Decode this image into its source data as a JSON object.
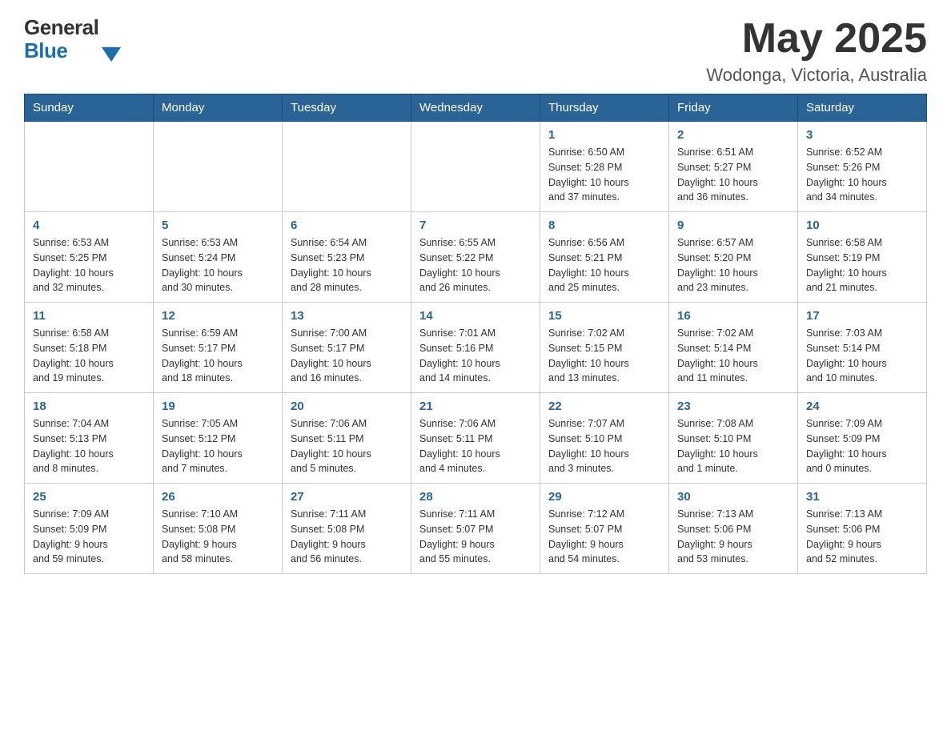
{
  "header": {
    "logo_general": "General",
    "logo_blue": "Blue",
    "month_year": "May 2025",
    "location": "Wodonga, Victoria, Australia"
  },
  "weekdays": [
    "Sunday",
    "Monday",
    "Tuesday",
    "Wednesday",
    "Thursday",
    "Friday",
    "Saturday"
  ],
  "weeks": [
    [
      {
        "day": "",
        "info": ""
      },
      {
        "day": "",
        "info": ""
      },
      {
        "day": "",
        "info": ""
      },
      {
        "day": "",
        "info": ""
      },
      {
        "day": "1",
        "info": "Sunrise: 6:50 AM\nSunset: 5:28 PM\nDaylight: 10 hours\nand 37 minutes."
      },
      {
        "day": "2",
        "info": "Sunrise: 6:51 AM\nSunset: 5:27 PM\nDaylight: 10 hours\nand 36 minutes."
      },
      {
        "day": "3",
        "info": "Sunrise: 6:52 AM\nSunset: 5:26 PM\nDaylight: 10 hours\nand 34 minutes."
      }
    ],
    [
      {
        "day": "4",
        "info": "Sunrise: 6:53 AM\nSunset: 5:25 PM\nDaylight: 10 hours\nand 32 minutes."
      },
      {
        "day": "5",
        "info": "Sunrise: 6:53 AM\nSunset: 5:24 PM\nDaylight: 10 hours\nand 30 minutes."
      },
      {
        "day": "6",
        "info": "Sunrise: 6:54 AM\nSunset: 5:23 PM\nDaylight: 10 hours\nand 28 minutes."
      },
      {
        "day": "7",
        "info": "Sunrise: 6:55 AM\nSunset: 5:22 PM\nDaylight: 10 hours\nand 26 minutes."
      },
      {
        "day": "8",
        "info": "Sunrise: 6:56 AM\nSunset: 5:21 PM\nDaylight: 10 hours\nand 25 minutes."
      },
      {
        "day": "9",
        "info": "Sunrise: 6:57 AM\nSunset: 5:20 PM\nDaylight: 10 hours\nand 23 minutes."
      },
      {
        "day": "10",
        "info": "Sunrise: 6:58 AM\nSunset: 5:19 PM\nDaylight: 10 hours\nand 21 minutes."
      }
    ],
    [
      {
        "day": "11",
        "info": "Sunrise: 6:58 AM\nSunset: 5:18 PM\nDaylight: 10 hours\nand 19 minutes."
      },
      {
        "day": "12",
        "info": "Sunrise: 6:59 AM\nSunset: 5:17 PM\nDaylight: 10 hours\nand 18 minutes."
      },
      {
        "day": "13",
        "info": "Sunrise: 7:00 AM\nSunset: 5:17 PM\nDaylight: 10 hours\nand 16 minutes."
      },
      {
        "day": "14",
        "info": "Sunrise: 7:01 AM\nSunset: 5:16 PM\nDaylight: 10 hours\nand 14 minutes."
      },
      {
        "day": "15",
        "info": "Sunrise: 7:02 AM\nSunset: 5:15 PM\nDaylight: 10 hours\nand 13 minutes."
      },
      {
        "day": "16",
        "info": "Sunrise: 7:02 AM\nSunset: 5:14 PM\nDaylight: 10 hours\nand 11 minutes."
      },
      {
        "day": "17",
        "info": "Sunrise: 7:03 AM\nSunset: 5:14 PM\nDaylight: 10 hours\nand 10 minutes."
      }
    ],
    [
      {
        "day": "18",
        "info": "Sunrise: 7:04 AM\nSunset: 5:13 PM\nDaylight: 10 hours\nand 8 minutes."
      },
      {
        "day": "19",
        "info": "Sunrise: 7:05 AM\nSunset: 5:12 PM\nDaylight: 10 hours\nand 7 minutes."
      },
      {
        "day": "20",
        "info": "Sunrise: 7:06 AM\nSunset: 5:11 PM\nDaylight: 10 hours\nand 5 minutes."
      },
      {
        "day": "21",
        "info": "Sunrise: 7:06 AM\nSunset: 5:11 PM\nDaylight: 10 hours\nand 4 minutes."
      },
      {
        "day": "22",
        "info": "Sunrise: 7:07 AM\nSunset: 5:10 PM\nDaylight: 10 hours\nand 3 minutes."
      },
      {
        "day": "23",
        "info": "Sunrise: 7:08 AM\nSunset: 5:10 PM\nDaylight: 10 hours\nand 1 minute."
      },
      {
        "day": "24",
        "info": "Sunrise: 7:09 AM\nSunset: 5:09 PM\nDaylight: 10 hours\nand 0 minutes."
      }
    ],
    [
      {
        "day": "25",
        "info": "Sunrise: 7:09 AM\nSunset: 5:09 PM\nDaylight: 9 hours\nand 59 minutes."
      },
      {
        "day": "26",
        "info": "Sunrise: 7:10 AM\nSunset: 5:08 PM\nDaylight: 9 hours\nand 58 minutes."
      },
      {
        "day": "27",
        "info": "Sunrise: 7:11 AM\nSunset: 5:08 PM\nDaylight: 9 hours\nand 56 minutes."
      },
      {
        "day": "28",
        "info": "Sunrise: 7:11 AM\nSunset: 5:07 PM\nDaylight: 9 hours\nand 55 minutes."
      },
      {
        "day": "29",
        "info": "Sunrise: 7:12 AM\nSunset: 5:07 PM\nDaylight: 9 hours\nand 54 minutes."
      },
      {
        "day": "30",
        "info": "Sunrise: 7:13 AM\nSunset: 5:06 PM\nDaylight: 9 hours\nand 53 minutes."
      },
      {
        "day": "31",
        "info": "Sunrise: 7:13 AM\nSunset: 5:06 PM\nDaylight: 9 hours\nand 52 minutes."
      }
    ]
  ]
}
